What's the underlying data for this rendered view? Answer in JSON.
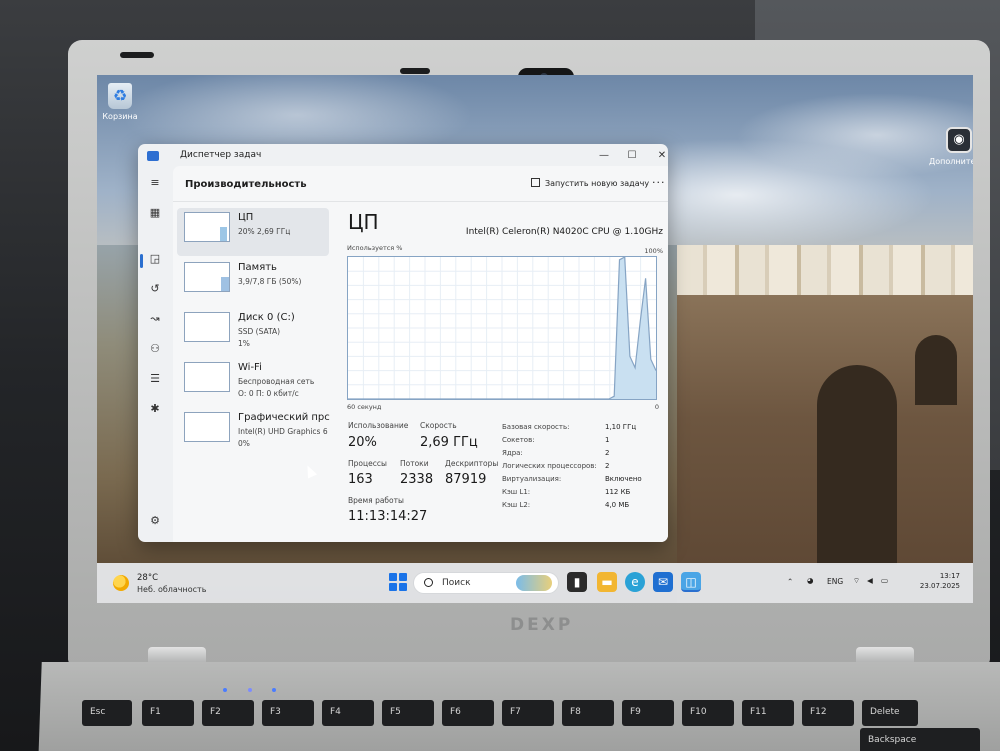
{
  "desktop": {
    "recycle_bin_label": "Корзина",
    "right_icon_label": "Дополнительно"
  },
  "task_manager": {
    "title": "Диспетчер задач",
    "window_controls": {
      "minimize": "—",
      "maximize": "☐",
      "close": "✕"
    },
    "section_title": "Производительность",
    "run_new_task": "Запустить новую задачу",
    "more": "···",
    "nav_icons": [
      "menu-icon",
      "processes-icon",
      "performance-icon",
      "history-icon",
      "startup-icon",
      "users-icon",
      "details-icon",
      "services-icon",
      "settings-icon"
    ],
    "resources": [
      {
        "name": "ЦП",
        "sub1": "20%  2,69 ГГц",
        "sub2": ""
      },
      {
        "name": "Память",
        "sub1": "3,9/7,8 ГБ (50%)",
        "sub2": ""
      },
      {
        "name": "Диск 0 (C:)",
        "sub1": "SSD (SATA)",
        "sub2": "1%"
      },
      {
        "name": "Wi-Fi",
        "sub1": "Беспроводная сеть",
        "sub2": "О: 0 П: 0 кбит/с"
      },
      {
        "name": "Графический прс",
        "sub1": "Intel(R) UHD Graphics 6",
        "sub2": "0%"
      }
    ],
    "cpu": {
      "title": "ЦП",
      "model": "Intel(R) Celeron(R) N4020C CPU @ 1.10GHz",
      "graph_label": "Используется %",
      "graph_max": "100%",
      "graph_window": "60 секунд",
      "graph_min": "0",
      "usage_history_pct": [
        0,
        0,
        0,
        0,
        0,
        0,
        0,
        0,
        0,
        0,
        0,
        0,
        0,
        0,
        0,
        0,
        0,
        0,
        0,
        0,
        0,
        0,
        0,
        0,
        0,
        0,
        0,
        0,
        0,
        0,
        0,
        0,
        0,
        0,
        0,
        0,
        0,
        0,
        0,
        0,
        0,
        0,
        0,
        0,
        0,
        0,
        0,
        0,
        0,
        0,
        0,
        2,
        98,
        100,
        30,
        22,
        55,
        85,
        28,
        20
      ],
      "stats": {
        "utilization_label": "Использование",
        "utilization": "20%",
        "speed_label": "Скорость",
        "speed": "2,69 ГГц",
        "processes_label": "Процессы",
        "processes": "163",
        "threads_label": "Потоки",
        "threads": "2338",
        "handles_label": "Дескрипторы",
        "handles": "87919",
        "uptime_label": "Время работы",
        "uptime": "11:13:14:27"
      },
      "specs": [
        {
          "label": "Базовая скорость:",
          "value": "1,10 ГГц"
        },
        {
          "label": "Сокетов:",
          "value": "1"
        },
        {
          "label": "Ядра:",
          "value": "2"
        },
        {
          "label": "Логических процессоров:",
          "value": "2"
        },
        {
          "label": "Виртуализация:",
          "value": "Включено"
        },
        {
          "label": "Кэш L1:",
          "value": "112 КБ"
        },
        {
          "label": "Кэш L2:",
          "value": "4,0 МБ"
        }
      ]
    }
  },
  "taskbar": {
    "weather_temp": "28°C",
    "weather_desc": "Неб. облачность",
    "search_placeholder": "Поиск",
    "language": "ENG",
    "time": "13:17",
    "date": "23.07.2025"
  },
  "laptop": {
    "brand": "DEXP",
    "keys": [
      "Esc",
      "F1",
      "F2",
      "F3",
      "F4",
      "F5",
      "F6",
      "F7",
      "F8",
      "F9",
      "F10",
      "F11",
      "F12",
      "Delete",
      "Backspace"
    ]
  },
  "colors": {
    "accent": "#2a6fcf",
    "graph_line": "#86a4c4",
    "graph_fill": "#c9e0f1"
  }
}
